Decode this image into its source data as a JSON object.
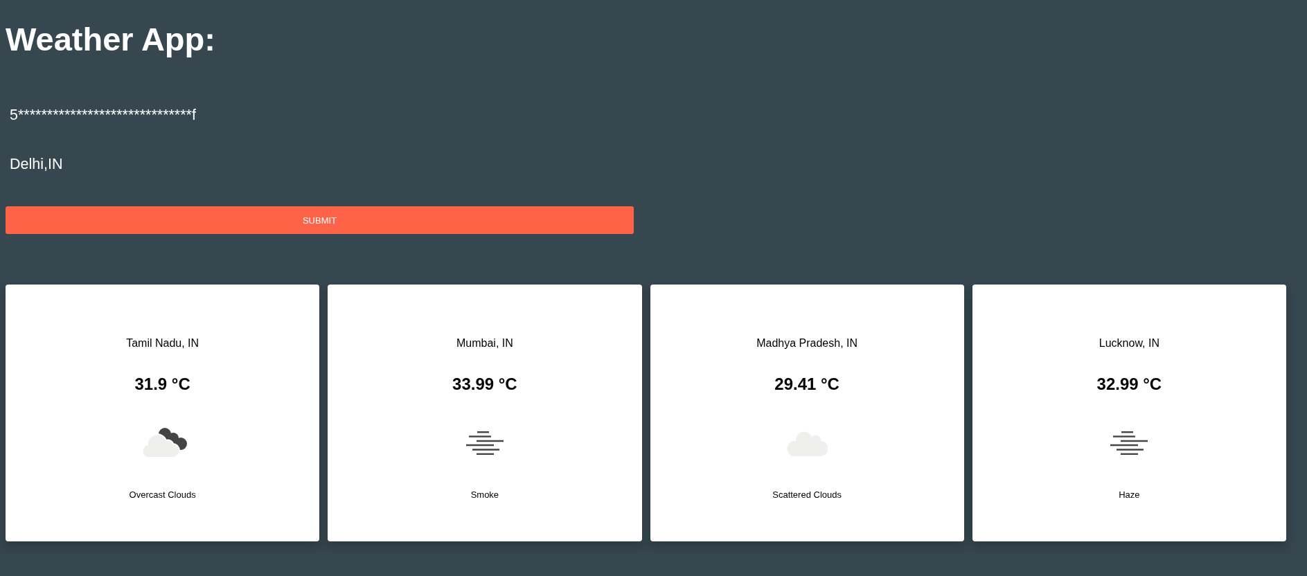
{
  "title": "Weather App:",
  "form": {
    "fields": [
      {
        "value": "5******************************f"
      },
      {
        "value": "Delhi,IN"
      }
    ],
    "submit": "SUBMIT"
  },
  "cards": [
    {
      "location": "Tamil Nadu, IN",
      "temperature": "31.9 °C",
      "kind": "overcast",
      "description": "Overcast Clouds"
    },
    {
      "location": "Mumbai, IN",
      "temperature": "33.99 °C",
      "kind": "mist",
      "description": "Smoke"
    },
    {
      "location": "Madhya Pradesh, IN",
      "temperature": "29.41 °C",
      "kind": "cloud",
      "description": "Scattered Clouds"
    },
    {
      "location": "Lucknow, IN",
      "temperature": "32.99 °C",
      "kind": "mist",
      "description": "Haze"
    }
  ]
}
